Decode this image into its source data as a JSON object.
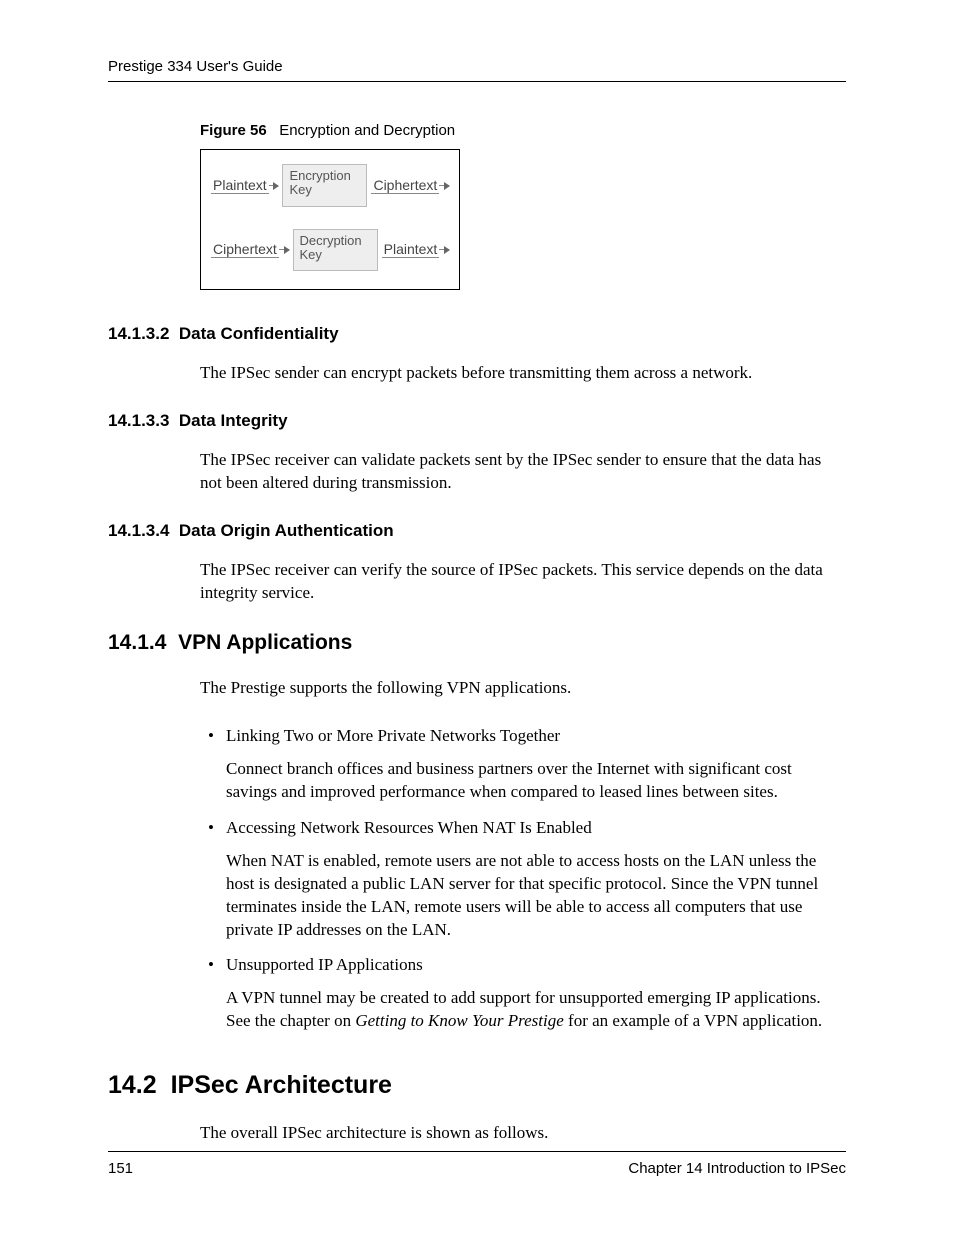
{
  "header": {
    "title": "Prestige 334 User's Guide"
  },
  "figure": {
    "label": "Figure 56",
    "title": "Encryption and Decryption",
    "row1": {
      "in": "Plaintext",
      "key": "Encryption Key",
      "out": "Ciphertext"
    },
    "row2": {
      "in": "Ciphertext",
      "key": "Decryption Key",
      "out": "Plaintext"
    }
  },
  "sections": {
    "s1": {
      "num": "14.1.3.2",
      "title": "Data Confidentiality",
      "body": "The IPSec sender can encrypt packets before transmitting them across a network."
    },
    "s2": {
      "num": "14.1.3.3",
      "title": "Data Integrity",
      "body": "The IPSec receiver can validate packets sent by the IPSec sender to ensure that the data has not been altered during transmission."
    },
    "s3": {
      "num": "14.1.3.4",
      "title": "Data Origin Authentication",
      "body": "The IPSec receiver can verify the source of IPSec packets. This service depends on the data integrity service."
    },
    "s4": {
      "num": "14.1.4",
      "title": "VPN Applications",
      "intro": "The Prestige supports the following VPN applications.",
      "bullets": [
        {
          "head": "Linking Two or More Private Networks Together",
          "body": "Connect branch offices and business partners over the Internet with significant cost savings and improved performance when compared to leased lines between sites."
        },
        {
          "head": "Accessing Network Resources When NAT Is Enabled",
          "body": "When NAT is enabled, remote users are not able to access hosts on the LAN unless the host is designated a public LAN server for that specific protocol. Since the VPN tunnel terminates inside the LAN, remote users will be able to access all computers that use private IP addresses on the LAN."
        },
        {
          "head": "Unsupported IP Applications",
          "body_pre": "A VPN tunnel may be created to add support for unsupported emerging IP applications. See the chapter on ",
          "body_italic": "Getting to Know Your Prestige",
          "body_post": " for an example of a VPN application."
        }
      ]
    },
    "s5": {
      "num": "14.2",
      "title": "IPSec Architecture",
      "body": "The overall IPSec architecture is shown as follows."
    }
  },
  "footer": {
    "page": "151",
    "chapter": "Chapter 14 Introduction to IPSec"
  }
}
